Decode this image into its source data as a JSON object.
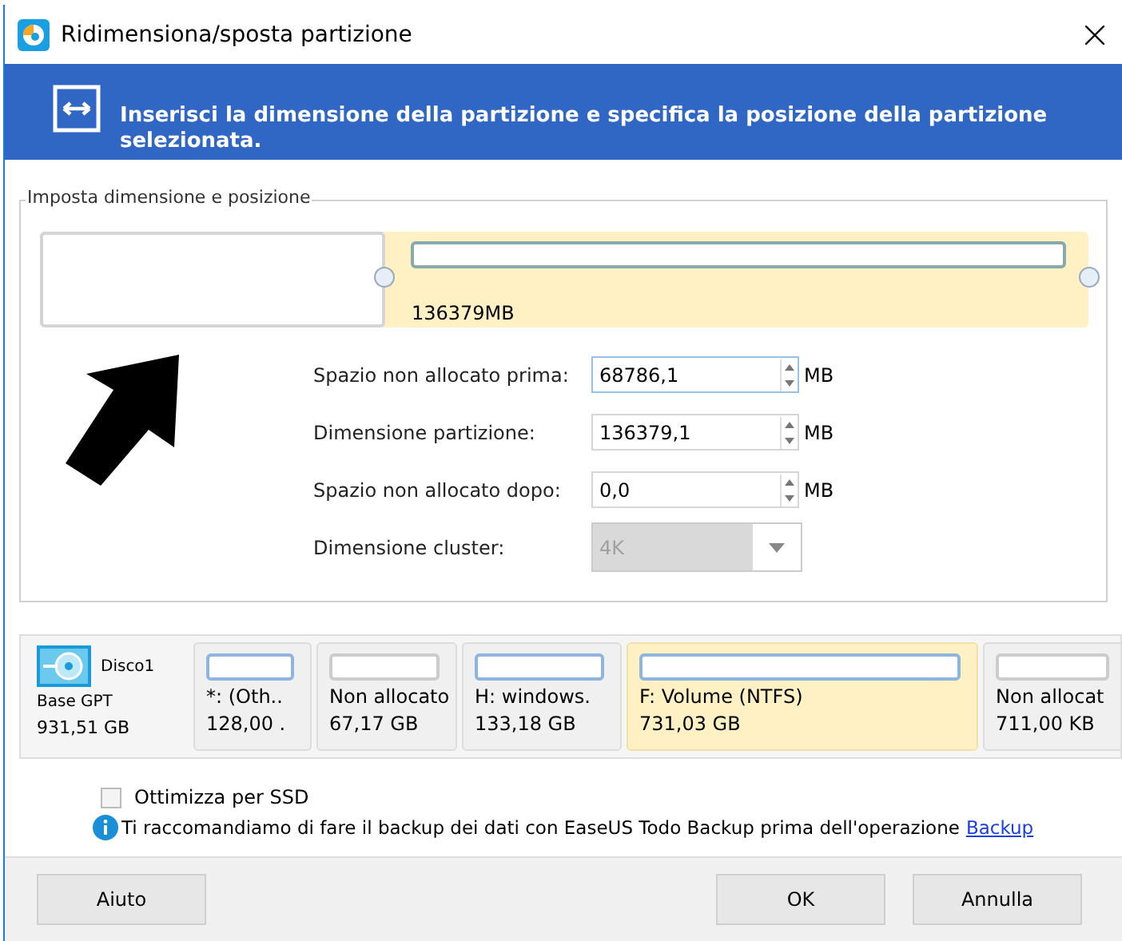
{
  "window": {
    "title": "Ridimensiona/sposta partizione"
  },
  "header": {
    "text": "Inserisci la dimensione della partizione e specifica la posizione della partizione selezionata."
  },
  "group": {
    "title": "Imposta dimensione e posizione",
    "partition_bar": {
      "unallocated_before": {
        "level": 0.33
      },
      "size": "136379MB"
    },
    "fields": [
      {
        "kind": "spin",
        "label": "Spazio non allocato prima:",
        "value": "68786,1",
        "unit": "MB",
        "disabled": false
      },
      {
        "kind": "spin",
        "label": "Dimensione partizione:",
        "value": "136379,1",
        "unit": "MB",
        "disabled": false
      },
      {
        "kind": "spin",
        "label": "Spazio non allocato dopo:",
        "value": "0,0",
        "unit": "MB",
        "disabled": false
      },
      {
        "kind": "combo",
        "label": "Dimensione cluster:",
        "value": "4K",
        "disabled": true
      }
    ]
  },
  "disk": {
    "name": "Disco1",
    "type": "Base GPT",
    "size": "931,51 GB",
    "partitions": [
      {
        "kind": "used",
        "label": "*: (Oth..",
        "size": "128,00 .",
        "selected": false
      },
      {
        "kind": "unallocated",
        "label": "Non allocato",
        "size": "67,17 GB",
        "selected": false
      },
      {
        "kind": "used",
        "label": "H: windows.",
        "size": "133,18 GB",
        "selected": false
      },
      {
        "kind": "used",
        "label": "F: Volume (NTFS)",
        "size": "731,03 GB",
        "selected": true
      },
      {
        "kind": "unallocated",
        "label": "Non allocat",
        "size": "711,00 KB",
        "selected": false
      }
    ]
  },
  "ssd_option": {
    "label": "Ottimizza per SSD",
    "checked": false
  },
  "notice": {
    "text": "Ti raccomandiamo di fare il backup dei dati con EaseUS Todo Backup prima dell'operazione",
    "link": "Backup"
  },
  "buttons": [
    {
      "kind": "help",
      "label": "Aiuto"
    },
    {
      "kind": "ok",
      "label": "OK"
    },
    {
      "kind": "cancel",
      "label": "Annulla"
    }
  ]
}
